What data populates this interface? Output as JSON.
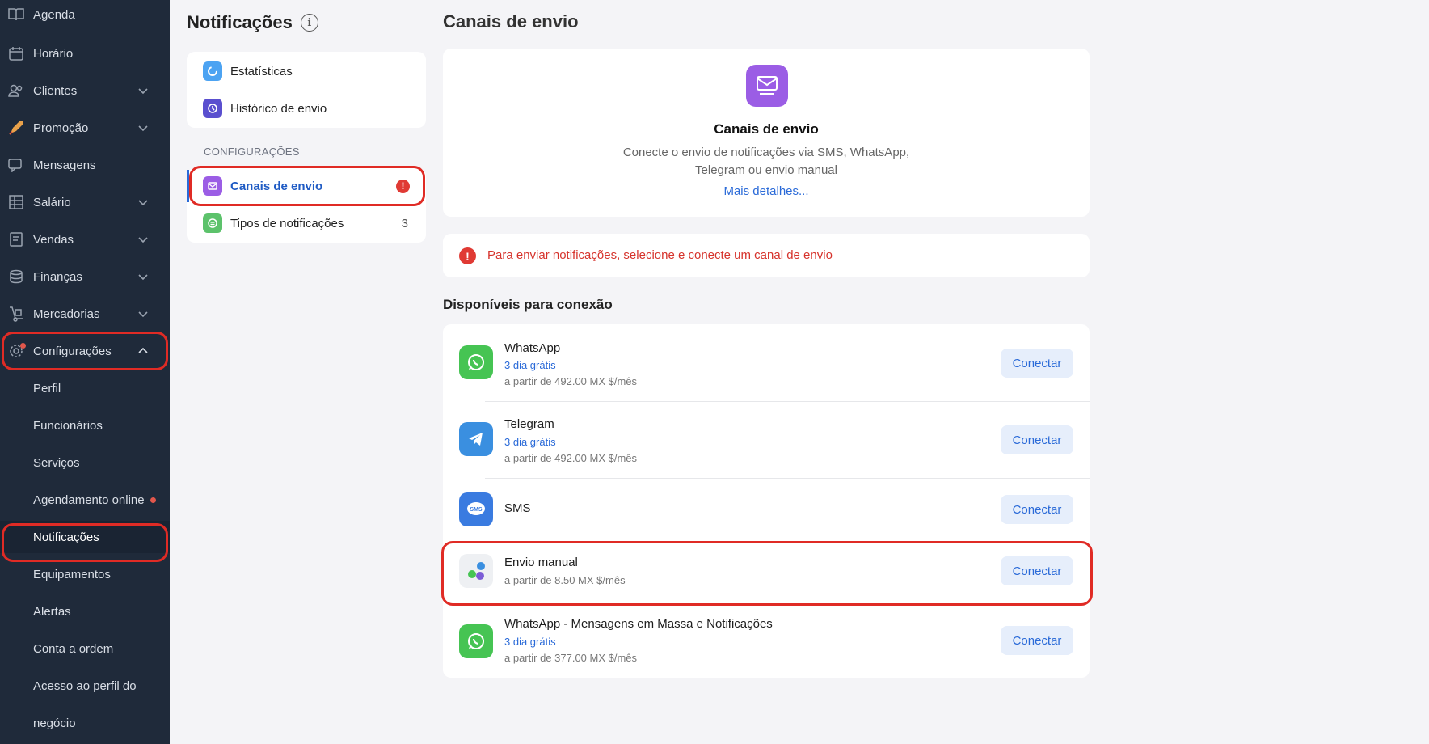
{
  "sidebar": {
    "items": [
      {
        "label": "Agenda",
        "icon": "book-icon"
      },
      {
        "label": "Horário",
        "icon": "calendar-icon"
      },
      {
        "label": "Clientes",
        "icon": "users-icon"
      },
      {
        "label": "Promoção",
        "icon": "rocket-icon"
      },
      {
        "label": "Mensagens",
        "icon": "chat-icon"
      },
      {
        "label": "Salário",
        "icon": "grid-icon"
      },
      {
        "label": "Vendas",
        "icon": "receipt-icon"
      },
      {
        "label": "Finanças",
        "icon": "coins-icon"
      },
      {
        "label": "Mercadorias",
        "icon": "dolly-icon"
      },
      {
        "label": "Configurações",
        "icon": "gear-icon"
      }
    ],
    "sub_items": [
      {
        "label": "Perfil"
      },
      {
        "label": "Funcionários"
      },
      {
        "label": "Serviços"
      },
      {
        "label": "Agendamento online"
      },
      {
        "label": "Notificações"
      },
      {
        "label": "Equipamentos"
      },
      {
        "label": "Alertas"
      },
      {
        "label": "Conta a ordem"
      },
      {
        "label": "Acesso ao perfil do"
      },
      {
        "label": "negócio"
      }
    ]
  },
  "notifications_panel": {
    "title": "Notificações",
    "menu": [
      {
        "label": "Estatísticas",
        "icon": "stats-icon"
      },
      {
        "label": "Histórico de envio",
        "icon": "history-icon"
      }
    ],
    "section_label": "CONFIGURAÇÕES",
    "settings": [
      {
        "label": "Canais de envio",
        "icon": "channels-icon",
        "alert": "!"
      },
      {
        "label": "Tipos de notificações",
        "icon": "notification-types-icon",
        "count": "3"
      }
    ]
  },
  "main": {
    "title": "Canais de envio",
    "hero": {
      "title": "Canais de envio",
      "description": "Conecte o envio de notificações via SMS, WhatsApp, Telegram ou envio manual",
      "link": "Mais detalhes..."
    },
    "alert_text": "Para enviar notificações, selecione e conecte um canal de envio",
    "available_title": "Disponíveis para conexão",
    "channels": [
      {
        "name": "WhatsApp",
        "trial": "3 dia grátis",
        "price": "a partir de 492.00 MX $/mês",
        "button": "Conectar",
        "icon": "whatsapp-icon"
      },
      {
        "name": "Telegram",
        "trial": "3 dia grátis",
        "price": "a partir de 492.00 MX $/mês",
        "button": "Conectar",
        "icon": "telegram-icon"
      },
      {
        "name": "SMS",
        "button": "Conectar",
        "icon": "sms-icon"
      },
      {
        "name": "Envio manual",
        "price": "a partir de 8.50 MX $/mês",
        "button": "Conectar",
        "icon": "manual-send-icon"
      },
      {
        "name": "WhatsApp - Mensagens em Massa e Notificações",
        "trial": "3 dia grátis",
        "price": "a partir de 377.00 MX $/mês",
        "button": "Conectar",
        "icon": "whatsapp-icon"
      }
    ]
  },
  "colors": {
    "sidebar_bg": "#1f2a3a",
    "accent_blue": "#2a6ad8",
    "alert_red": "#d6332c",
    "highlight_red": "#e02b25"
  }
}
